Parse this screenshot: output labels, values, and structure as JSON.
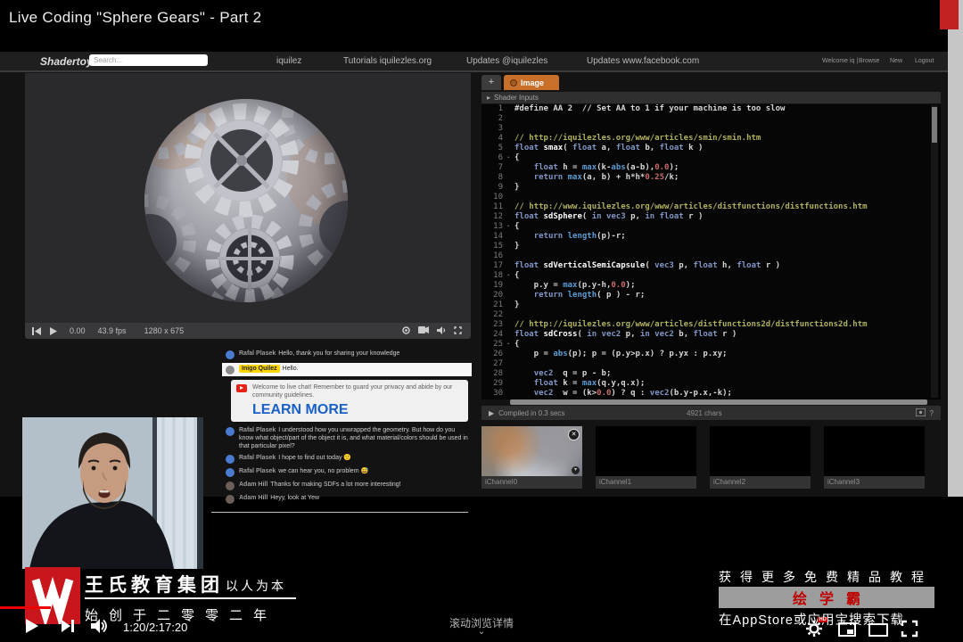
{
  "video": {
    "title": "Live Coding \"Sphere Gears\" - Part 2",
    "time_current": "1:20",
    "time_separator": " / ",
    "time_total": "2:17:20",
    "scroll_hint": "滚动浏览详情",
    "scroll_chevron": "⌄"
  },
  "shadertoy": {
    "logo": "Shadertoy",
    "search_placeholder": "Search...",
    "nav": [
      "iquilez",
      "Tutorials iquilezles.org",
      "Updates @iquilezles",
      "Updates www.facebook.com"
    ],
    "user_nav": [
      "Welcome iq |",
      "Browse",
      "New",
      "Logout"
    ],
    "preview": {
      "time": "0.00",
      "fps": "43.9 fps",
      "resolution": "1280 x 675"
    },
    "tabs": {
      "add": "+",
      "image": "Image"
    },
    "inputs_bar": {
      "arrow": "▸",
      "label": "Shader Inputs"
    },
    "status": {
      "play": "▶",
      "compiled": "Compiled in 0.3 secs",
      "chars": "4921 chars",
      "help": "?"
    },
    "channels": [
      "iChannel0",
      "iChannel1",
      "iChannel2",
      "iChannel3"
    ],
    "channel_close_glyph": "✕",
    "channel_settings_glyph": "▾",
    "fold_glyph": "·",
    "code": [
      {
        "n": "1",
        "seg": [
          [
            "d",
            "#define AA 2  // Set AA to 1 if your machine is too slow"
          ]
        ]
      },
      {
        "n": "2",
        "seg": []
      },
      {
        "n": "3",
        "seg": []
      },
      {
        "n": "4",
        "seg": [
          [
            "c",
            "// http://iquilezles.org/www/articles/smin/smin.htm"
          ]
        ]
      },
      {
        "n": "5",
        "seg": [
          [
            "k",
            "float "
          ],
          [
            "f",
            "smax"
          ],
          [
            "d",
            "( "
          ],
          [
            "k",
            "float"
          ],
          [
            "d",
            " a, "
          ],
          [
            "k",
            "float"
          ],
          [
            "d",
            " b, "
          ],
          [
            "k",
            "float"
          ],
          [
            "d",
            " k )"
          ]
        ]
      },
      {
        "n": "6",
        "fold": true,
        "seg": [
          [
            "d",
            "{"
          ]
        ]
      },
      {
        "n": "7",
        "seg": [
          [
            "d",
            "    "
          ],
          [
            "k",
            "float"
          ],
          [
            "d",
            " h = "
          ],
          [
            "b",
            "max"
          ],
          [
            "d",
            "(k-"
          ],
          [
            "b",
            "abs"
          ],
          [
            "d",
            "(a-b),"
          ],
          [
            "n2",
            "0.0"
          ],
          [
            "d",
            ");"
          ]
        ]
      },
      {
        "n": "8",
        "seg": [
          [
            "d",
            "    "
          ],
          [
            "k",
            "return "
          ],
          [
            "b",
            "max"
          ],
          [
            "d",
            "(a, b) + h*h*"
          ],
          [
            "n2",
            "0.25"
          ],
          [
            "d",
            "/k;"
          ]
        ]
      },
      {
        "n": "9",
        "seg": [
          [
            "d",
            "}"
          ]
        ]
      },
      {
        "n": "10",
        "seg": []
      },
      {
        "n": "11",
        "seg": [
          [
            "c",
            "// http://www.iquilezles.org/www/articles/distfunctions/distfunctions.htm"
          ]
        ]
      },
      {
        "n": "12",
        "seg": [
          [
            "k",
            "float "
          ],
          [
            "f",
            "sdSphere"
          ],
          [
            "d",
            "( "
          ],
          [
            "k",
            "in vec3"
          ],
          [
            "d",
            " p, "
          ],
          [
            "k",
            "in float"
          ],
          [
            "d",
            " r )"
          ]
        ]
      },
      {
        "n": "13",
        "fold": true,
        "seg": [
          [
            "d",
            "{"
          ]
        ]
      },
      {
        "n": "14",
        "seg": [
          [
            "d",
            "    "
          ],
          [
            "k",
            "return "
          ],
          [
            "b",
            "length"
          ],
          [
            "d",
            "(p)-r;"
          ]
        ]
      },
      {
        "n": "15",
        "seg": [
          [
            "d",
            "}"
          ]
        ]
      },
      {
        "n": "16",
        "seg": []
      },
      {
        "n": "17",
        "seg": [
          [
            "k",
            "float "
          ],
          [
            "f",
            "sdVerticalSemiCapsule"
          ],
          [
            "d",
            "( "
          ],
          [
            "k",
            "vec3"
          ],
          [
            "d",
            " p, "
          ],
          [
            "k",
            "float"
          ],
          [
            "d",
            " h, "
          ],
          [
            "k",
            "float"
          ],
          [
            "d",
            " r )"
          ]
        ]
      },
      {
        "n": "18",
        "fold": true,
        "seg": [
          [
            "d",
            "{"
          ]
        ]
      },
      {
        "n": "19",
        "seg": [
          [
            "d",
            "    p.y = "
          ],
          [
            "b",
            "max"
          ],
          [
            "d",
            "(p.y-h,"
          ],
          [
            "n2",
            "0.0"
          ],
          [
            "d",
            ");"
          ]
        ]
      },
      {
        "n": "20",
        "seg": [
          [
            "d",
            "    "
          ],
          [
            "k",
            "return "
          ],
          [
            "b",
            "length"
          ],
          [
            "d",
            "( p ) - r;"
          ]
        ]
      },
      {
        "n": "21",
        "seg": [
          [
            "d",
            "}"
          ]
        ]
      },
      {
        "n": "22",
        "seg": []
      },
      {
        "n": "23",
        "seg": [
          [
            "c",
            "// http://iquilezles.org/www/articles/distfunctions2d/distfunctions2d.htm"
          ]
        ]
      },
      {
        "n": "24",
        "seg": [
          [
            "k",
            "float "
          ],
          [
            "f",
            "sdCross"
          ],
          [
            "d",
            "( "
          ],
          [
            "k",
            "in vec2"
          ],
          [
            "d",
            " p, "
          ],
          [
            "k",
            "in vec2"
          ],
          [
            "d",
            " b, "
          ],
          [
            "k",
            "float"
          ],
          [
            "d",
            " r )"
          ]
        ]
      },
      {
        "n": "25",
        "fold": true,
        "seg": [
          [
            "d",
            "{"
          ]
        ]
      },
      {
        "n": "26",
        "seg": [
          [
            "d",
            "    p = "
          ],
          [
            "b",
            "abs"
          ],
          [
            "d",
            "(p); p = (p.y>p.x) ? p.yx : p.xy;"
          ]
        ]
      },
      {
        "n": "27",
        "seg": []
      },
      {
        "n": "28",
        "seg": [
          [
            "d",
            "    "
          ],
          [
            "k",
            "vec2"
          ],
          [
            "d",
            "  q = p - b;"
          ]
        ]
      },
      {
        "n": "29",
        "seg": [
          [
            "d",
            "    "
          ],
          [
            "k",
            "float"
          ],
          [
            "d",
            " k = "
          ],
          [
            "b",
            "max"
          ],
          [
            "d",
            "(q.y,q.x);"
          ]
        ]
      },
      {
        "n": "30",
        "seg": [
          [
            "d",
            "    "
          ],
          [
            "k",
            "vec2"
          ],
          [
            "d",
            "  w = (k>"
          ],
          [
            "n2",
            "0.0"
          ],
          [
            "d",
            ") ? q : "
          ],
          [
            "k",
            "vec2"
          ],
          [
            "d",
            "(b.y-p.x,-k);"
          ]
        ]
      }
    ]
  },
  "chat": {
    "messages": [
      {
        "type": "user",
        "author": "Rafal Plasek",
        "avatar_color": "#4a7bd0",
        "text": "Hello, thank you for sharing your knowledge"
      },
      {
        "type": "highlight",
        "author": "Inigo Quilez",
        "text": "Hello."
      },
      {
        "type": "system",
        "text": "Welcome to live chat! Remember to guard your privacy and abide by our community guidelines.",
        "link": "LEARN MORE"
      },
      {
        "type": "user",
        "author": "Rafal Plasek",
        "avatar_color": "#4a7bd0",
        "text": "I understood how you unwrapped the geometry. But how do you know what object/part of the object it is, and what material/colors should be used in that particular pixel?"
      },
      {
        "type": "user",
        "author": "Rafal Plasek",
        "avatar_color": "#4a7bd0",
        "text": "I hope to find out today 🙂"
      },
      {
        "type": "user",
        "author": "Rafal Plasek",
        "avatar_color": "#4a7bd0",
        "text": "we can hear you, no problem 😅"
      },
      {
        "type": "user",
        "author": "Adam Hill",
        "avatar_color": "#6b5f57",
        "text": "Thanks for making SDFs a lot more interesting!"
      },
      {
        "type": "user",
        "author": "Adam Hill",
        "avatar_color": "#6b5f57",
        "text": "Heyy, look at Yew"
      }
    ]
  },
  "banner": {
    "company": "王氏教育集团",
    "slogan": "以人为本",
    "since": "始创于二零零二年",
    "promo_line1": "获得更多免费精品教程",
    "brand": "绘学霸",
    "promo_line2": "在AppStore或应用宝搜索下载",
    "brand_color": "#c00000",
    "logo_color": "#c9161c"
  },
  "colors": {
    "tab_accent": "#c8702a",
    "code_keyword": "#7f96c6",
    "code_builtin": "#5b9bd5",
    "code_comment": "#b0b060",
    "code_number": "#c96a6a",
    "chat_highlight_badge": "#ffd600",
    "seekbar_red": "#ee0000"
  }
}
